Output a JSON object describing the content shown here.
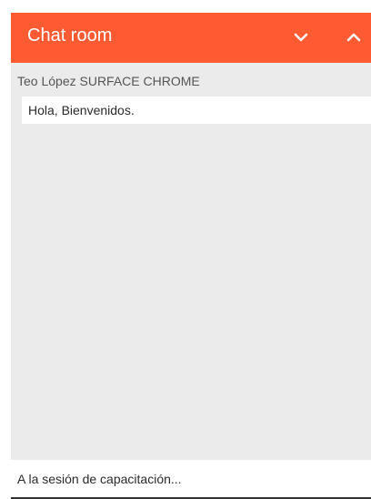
{
  "header": {
    "title": "Chat room",
    "collapse_icon": "chevron-down-icon",
    "expand_icon": "chevron-up-icon",
    "color": "#fe5b33"
  },
  "messages": [
    {
      "sender": "Teo López SURFACE CHROME",
      "text": "Hola, Bienvenidos."
    }
  ],
  "composer": {
    "value": "A la sesión de capacitación..."
  },
  "colors": {
    "panel_background": "#ebebeb",
    "accent": "#fe5b33"
  }
}
